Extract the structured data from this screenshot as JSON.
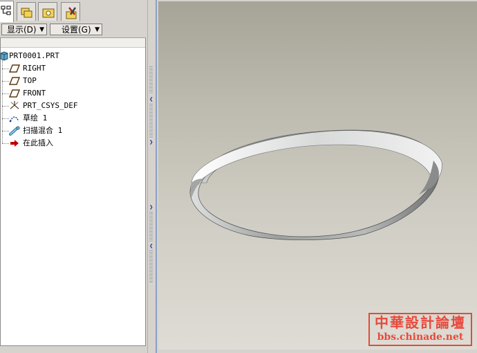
{
  "toolbar": {
    "display_label": "显示(D)",
    "settings_label": "设置(G)"
  },
  "tabs": [
    {
      "icon": "model-tree-icon",
      "active": true
    },
    {
      "icon": "folder-browser-icon",
      "active": false
    },
    {
      "icon": "favorites-folder-icon",
      "active": false
    },
    {
      "icon": "tools-icon",
      "active": false
    }
  ],
  "tree": {
    "root": "PRT0001.PRT",
    "items": [
      {
        "label": "RIGHT",
        "icon": "datum-plane-icon"
      },
      {
        "label": "TOP",
        "icon": "datum-plane-icon"
      },
      {
        "label": "FRONT",
        "icon": "datum-plane-icon"
      },
      {
        "label": "PRT_CSYS_DEF",
        "icon": "coordinate-system-icon"
      },
      {
        "label": "草绘 1",
        "icon": "sketch-icon"
      },
      {
        "label": "扫描混合 1",
        "icon": "swept-blend-icon"
      },
      {
        "label": "在此插入",
        "icon": "insert-here-arrow-icon"
      }
    ]
  },
  "watermark": {
    "line1": "中華設計論壇",
    "line2": "bbs.chinade.net"
  },
  "colors": {
    "viewport_top": "#a6a497",
    "viewport_bottom": "#dedcd4",
    "watermark": "#e8493b",
    "insert_arrow": "#c00000"
  }
}
